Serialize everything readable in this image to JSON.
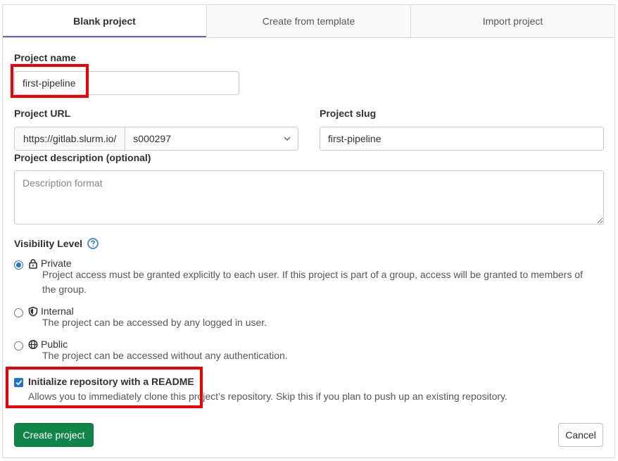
{
  "tabs": [
    {
      "label": "Blank project",
      "active": true
    },
    {
      "label": "Create from template",
      "active": false
    },
    {
      "label": "Import project",
      "active": false
    }
  ],
  "form": {
    "project_name": {
      "label": "Project name",
      "value": "first-pipeline"
    },
    "project_url": {
      "label": "Project URL",
      "prefix": "https://gitlab.slurm.io/",
      "namespace": "s000297"
    },
    "project_slug": {
      "label": "Project slug",
      "value": "first-pipeline"
    },
    "description": {
      "label": "Project description (optional)",
      "placeholder": "Description format"
    },
    "visibility": {
      "label": "Visibility Level",
      "selected": "Private",
      "options": [
        {
          "name": "Private",
          "icon": "lock-icon",
          "description": "Project access must be granted explicitly to each user. If this project is part of a group, access will be granted to members of the group."
        },
        {
          "name": "Internal",
          "icon": "shield-icon",
          "description": "The project can be accessed by any logged in user."
        },
        {
          "name": "Public",
          "icon": "globe-icon",
          "description": "The project can be accessed without any authentication."
        }
      ]
    },
    "readme": {
      "checked": true,
      "label": "Initialize repository with a README",
      "description": "Allows you to immediately clone this project’s repository. Skip this if you plan to push up an existing repository."
    }
  },
  "actions": {
    "create_label": "Create project",
    "cancel_label": "Cancel"
  },
  "colors": {
    "primary": "#108548",
    "accent": "#1f75cb",
    "highlight": "#ef0000",
    "tab_indicator": "#6666c4"
  }
}
